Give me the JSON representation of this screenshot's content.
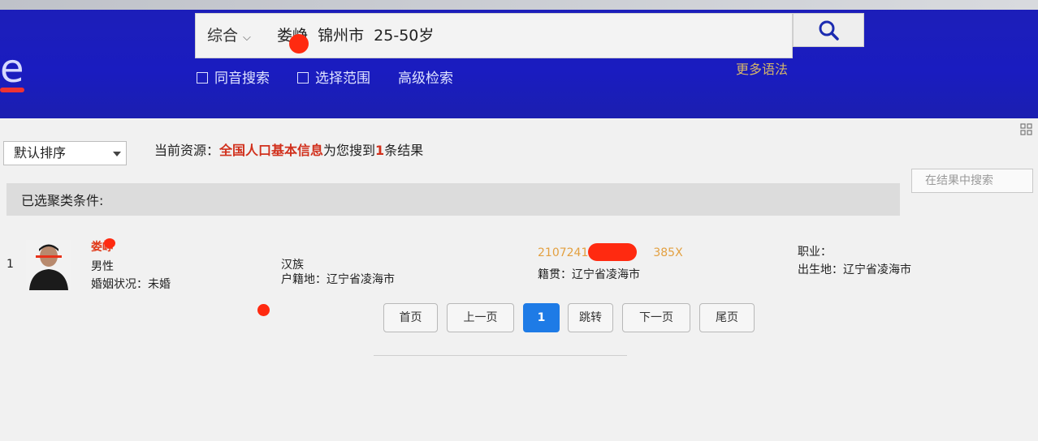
{
  "header": {
    "search_scope": "综合",
    "search_query_prefix": "娄",
    "search_query_rest": "峥  锦州市  25-50岁",
    "options": [
      {
        "label": "同音搜索",
        "checked": false
      },
      {
        "label": "选择范围",
        "checked": false
      }
    ],
    "advanced_search": "高级检索",
    "more_syntax": "更多语法"
  },
  "toolbar": {
    "sort_label": "默认排序",
    "source_prefix": "当前资源：",
    "source_name": "全国人口基本信息",
    "source_mid": "为您搜到",
    "result_count": "1",
    "source_suffix": "条结果",
    "search_in_results_placeholder": "在结果中搜索"
  },
  "filter": {
    "label": "已选聚类条件:"
  },
  "results": [
    {
      "index": "1",
      "name": "娄峥",
      "gender": "男性",
      "marital": "婚姻状况：未婚",
      "ethnicity": "汉族",
      "household": "户籍地：辽宁省凌海市",
      "id_prefix": "2107241",
      "id_suffix": "385X",
      "native_place": "籍贯：辽宁省凌海市",
      "occupation": "职业：",
      "birthplace": "出生地：辽宁省凌海市"
    }
  ],
  "pagination": {
    "first": "首页",
    "prev": "上一页",
    "current": "1",
    "jump": "跳转",
    "next": "下一页",
    "last": "尾页"
  },
  "colors": {
    "header_blue": "#1a1cc0",
    "accent_red": "#d1301c",
    "active_page": "#1e7be6"
  }
}
